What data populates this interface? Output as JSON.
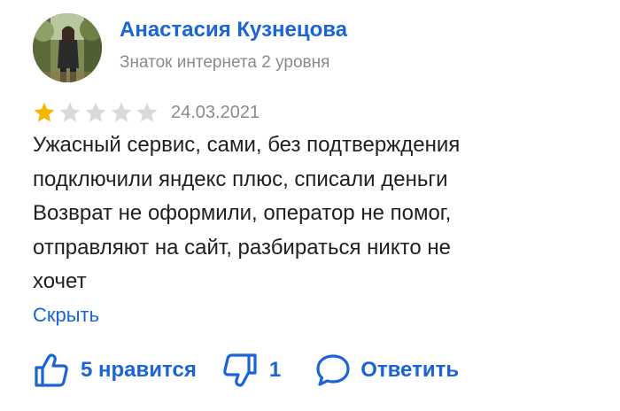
{
  "author": {
    "name": "Анастасия Кузнецова",
    "level": "Знаток интернета 2 уровня"
  },
  "review": {
    "rating": 1,
    "max_rating": 5,
    "date": "24.03.2021",
    "text_lines": [
      "Ужасный сервис, сами, без подтверждения",
      "подключили яндекс плюс, списали деньги",
      "Возврат не оформили, оператор не помог,",
      "отправляют на сайт, разбираться никто не",
      "хочет"
    ],
    "collapse_label": "Скрыть"
  },
  "actions": {
    "like_label": "5 нравится",
    "dislike_label": "1",
    "reply_label": "Ответить"
  },
  "colors": {
    "accent": "#1a64d6",
    "star_filled": "#f5b700",
    "star_empty": "#d9d9d9",
    "muted_text": "#8a8a8a"
  },
  "icons": {
    "like": "thumbs-up-icon",
    "dislike": "thumbs-down-icon",
    "reply": "speech-bubble-icon"
  }
}
